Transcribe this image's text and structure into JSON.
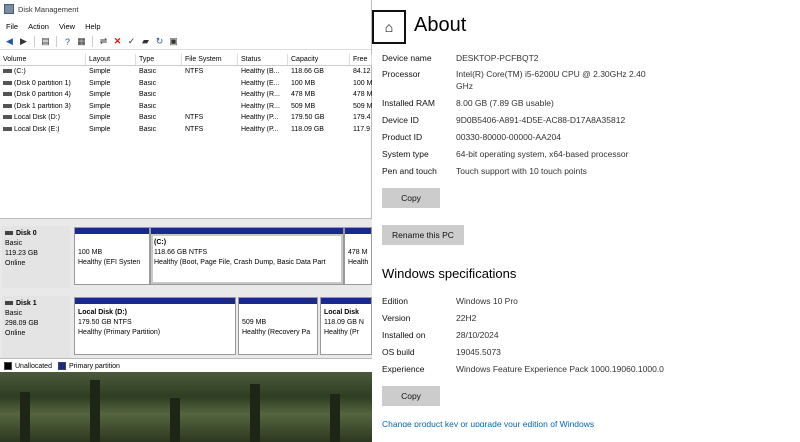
{
  "disk_management": {
    "title": "Disk Management",
    "menu": [
      "File",
      "Action",
      "View",
      "Help"
    ],
    "columns": [
      "Volume",
      "Layout",
      "Type",
      "File System",
      "Status",
      "Capacity",
      "Free"
    ],
    "volumes": [
      [
        "(C:)",
        "Simple",
        "Basic",
        "NTFS",
        "Healthy (B...",
        "118.66 GB",
        "84.12"
      ],
      [
        "(Disk 0 partition 1)",
        "Simple",
        "Basic",
        "",
        "Healthy (E...",
        "100 MB",
        "100 M"
      ],
      [
        "(Disk 0 partition 4)",
        "Simple",
        "Basic",
        "",
        "Healthy (R...",
        "478 MB",
        "478 M"
      ],
      [
        "(Disk 1 partition 3)",
        "Simple",
        "Basic",
        "",
        "Healthy (R...",
        "509 MB",
        "509 M"
      ],
      [
        "Local Disk (D:)",
        "Simple",
        "Basic",
        "NTFS",
        "Healthy (P...",
        "179.50 GB",
        "179.4"
      ],
      [
        "Local Disk (E:)",
        "Simple",
        "Basic",
        "NTFS",
        "Healthy (P...",
        "118.09 GB",
        "117.9"
      ]
    ],
    "disks": [
      {
        "name": "Disk 0",
        "type": "Basic",
        "size": "119.23 GB",
        "status": "Online",
        "partitions": [
          {
            "title": "",
            "line1": "100 MB",
            "line2": "Healthy (EFI Systen"
          },
          {
            "title": "(C:)",
            "line1": "118.66 GB NTFS",
            "line2": "Healthy (Boot, Page File, Crash Dump, Basic Data Part"
          },
          {
            "title": "",
            "line1": "478 M",
            "line2": "Health"
          }
        ]
      },
      {
        "name": "Disk 1",
        "type": "Basic",
        "size": "298.09 GB",
        "status": "Online",
        "partitions": [
          {
            "title": "Local Disk  (D:)",
            "line1": "179.50 GB NTFS",
            "line2": "Healthy (Primary Partition)"
          },
          {
            "title": "",
            "line1": "509 MB",
            "line2": "Healthy (Recovery Pa"
          },
          {
            "title": "Local Disk",
            "line1": "118.09 GB N",
            "line2": "Healthy (Pr"
          }
        ]
      }
    ],
    "legend": [
      "Unallocated",
      "Primary partition"
    ]
  },
  "about": {
    "title": "About",
    "device_specs": [
      {
        "label": "Device name",
        "value": "DESKTOP-PCFBQT2"
      },
      {
        "label": "Processor",
        "value": "Intel(R) Core(TM) i5-6200U CPU @ 2.30GHz   2.40"
      },
      {
        "label": "",
        "value": "GHz"
      },
      {
        "label": "Installed RAM",
        "value": "8.00 GB (7.89 GB usable)"
      },
      {
        "label": "Device ID",
        "value": "9D0B5406-A891-4D5E-AC88-D17A8A35812"
      },
      {
        "label": "Product ID",
        "value": "00330-80000-00000-AA204"
      },
      {
        "label": "System type",
        "value": "64-bit operating system, x64-based processor"
      },
      {
        "label": "Pen and touch",
        "value": "Touch support with 10 touch points"
      }
    ],
    "copy_label": "Copy",
    "rename_label": "Rename this PC",
    "windows_spec_title": "Windows specifications",
    "windows_specs": [
      {
        "label": "Edition",
        "value": "Windows 10 Pro"
      },
      {
        "label": "Version",
        "value": "22H2"
      },
      {
        "label": "Installed on",
        "value": "28/10/2024"
      },
      {
        "label": "OS build",
        "value": "19045.5073"
      },
      {
        "label": "Experience",
        "value": "Windows Feature Experience Pack 1000.19060.1000.0"
      }
    ],
    "copy2_label": "Copy",
    "upgrade_link": "Change product key or upgrade your edition of Windows"
  }
}
